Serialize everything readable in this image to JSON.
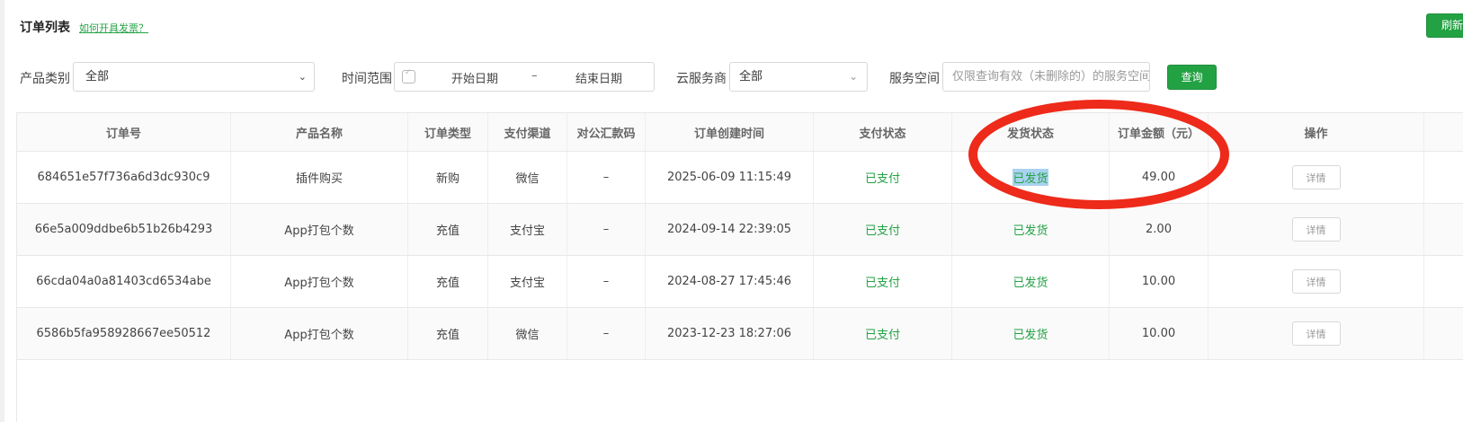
{
  "header": {
    "title": "订单列表",
    "invoice_link": "如何开具发票？",
    "refresh_label": "刷新"
  },
  "filters": {
    "product_type_label": "产品类别",
    "product_type_value": "全部",
    "time_range_label": "时间范围",
    "start_date": "开始日期",
    "date_separator": "–",
    "end_date": "结束日期",
    "cloud_provider_label": "云服务商",
    "cloud_provider_value": "全部",
    "service_space_label": "服务空间",
    "service_space_placeholder": "仅限查询有效（未删除的）的服务空间",
    "query_label": "查询"
  },
  "table": {
    "headers": [
      "订单号",
      "产品名称",
      "订单类型",
      "支付渠道",
      "对公汇款码",
      "订单创建时间",
      "支付状态",
      "发货状态",
      "订单金额（元）",
      "操作"
    ],
    "rows": [
      [
        "684651e57f736a6d3dc930c9",
        "插件购买",
        "新购",
        "微信",
        "–",
        "2025-06-09 11:15:49",
        "已支付",
        "已发货",
        "49.00",
        "详情"
      ],
      [
        "66e5a009ddbe6b51b26b4293",
        "App打包个数",
        "充值",
        "支付宝",
        "–",
        "2024-09-14 22:39:05",
        "已支付",
        "已发货",
        "2.00",
        "详情"
      ],
      [
        "66cda04a0a81403cd6534abe",
        "App打包个数",
        "充值",
        "支付宝",
        "–",
        "2024-08-27 17:45:46",
        "已支付",
        "已发货",
        "10.00",
        "详情"
      ],
      [
        "6586b5fa958928667ee50512",
        "App打包个数",
        "充值",
        "微信",
        "–",
        "2023-12-23 18:27:06",
        "已支付",
        "已发货",
        "10.00",
        "详情"
      ]
    ]
  },
  "colors": {
    "accent": "#23a244",
    "annotation": "#ee2a1a",
    "highlight": "#a9d2f0"
  },
  "icons": {
    "calendar": "calendar-icon",
    "chevron": "chevron-down-icon"
  }
}
